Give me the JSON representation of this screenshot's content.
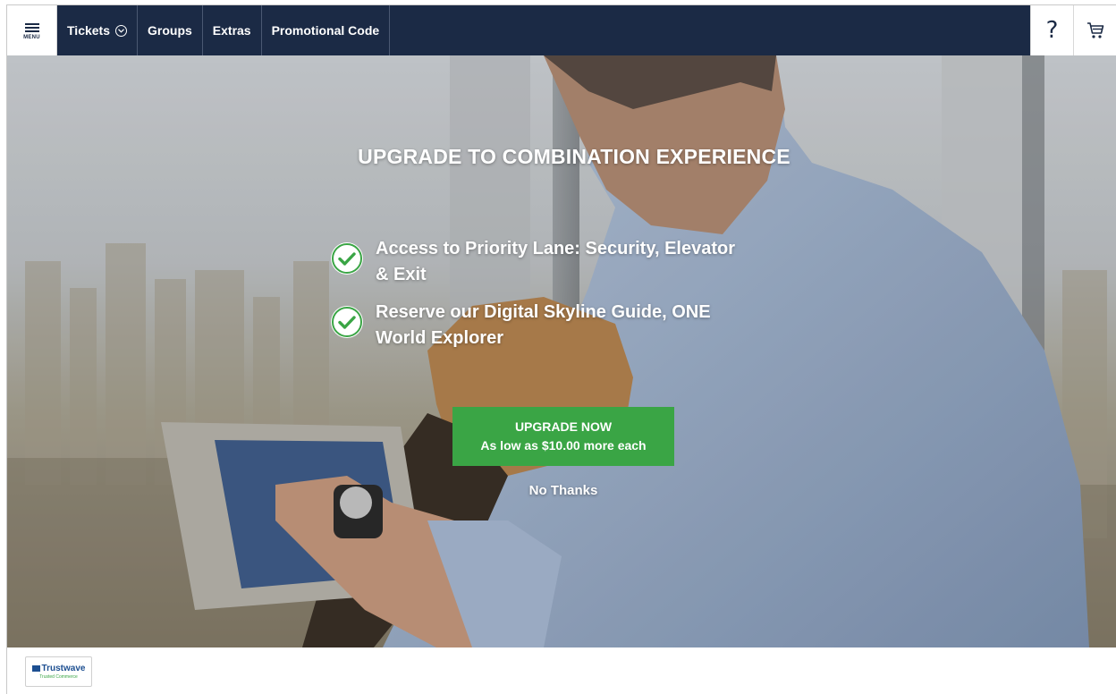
{
  "nav": {
    "menu_label": "MENU",
    "items": [
      {
        "label": "Tickets"
      },
      {
        "label": "Groups"
      },
      {
        "label": "Extras"
      },
      {
        "label": "Promotional Code"
      }
    ],
    "help_glyph": "?"
  },
  "hero": {
    "title": "UPGRADE TO COMBINATION EXPERIENCE",
    "features": [
      {
        "line1": "Access to Priority Lane: Security, Elevator",
        "line2": "& Exit"
      },
      {
        "line1": "Reserve our Digital Skyline Guide, ONE",
        "line2": "World Explorer"
      }
    ],
    "upgrade_button": {
      "line1": "UPGRADE NOW",
      "line2": "As low as $10.00 more each"
    },
    "no_thanks": "No Thanks"
  },
  "footer": {
    "trust_badge": {
      "line1": "Trustwave",
      "line2": "Trusted Commerce"
    }
  },
  "colors": {
    "nav_bg": "#1b2a45",
    "accent_green": "#3aa545",
    "check_green": "#3aa545"
  },
  "icons": [
    "hamburger-menu-icon",
    "chevron-circle-down-icon",
    "help-icon",
    "cart-icon",
    "check-circle-icon"
  ]
}
